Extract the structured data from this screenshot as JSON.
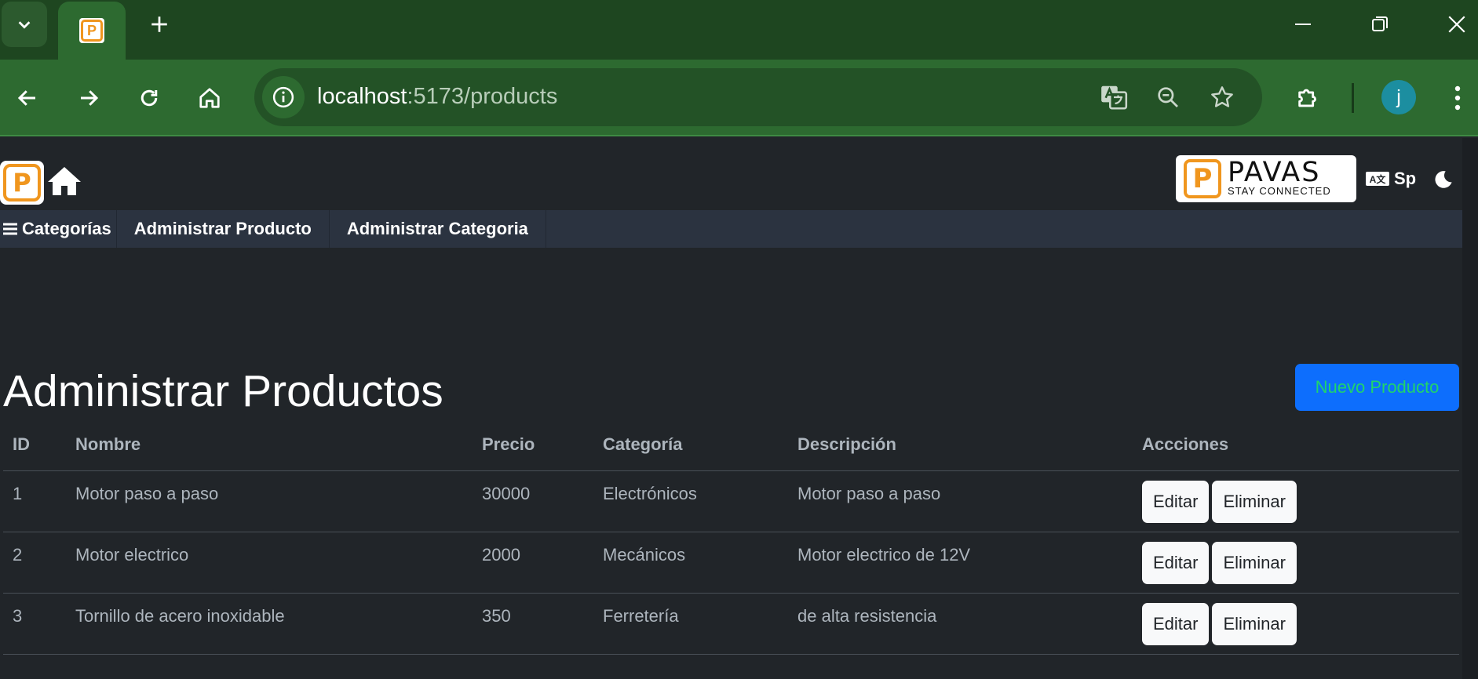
{
  "browser": {
    "tab_icon_letter": "P",
    "address": {
      "host": "localhost",
      "path": ":5173/products"
    },
    "profile_initial": "j",
    "colors": {
      "frame": "#1e4620",
      "toolbar": "#2d6a30",
      "omnibox": "#235226",
      "avatar": "#1c8ea0"
    }
  },
  "header": {
    "brand_letter": "P",
    "pavas_logo": {
      "name": "PAVAS",
      "tagline": "STAY CONNECTED"
    },
    "language": {
      "icon_text": "A文",
      "label": "Sp"
    }
  },
  "menu": {
    "items": [
      {
        "label": "Categorías"
      },
      {
        "label": "Administrar Producto"
      },
      {
        "label": "Administrar Categoria"
      }
    ]
  },
  "main": {
    "title": "Administrar Productos",
    "new_button": "Nuevo Producto",
    "table": {
      "headers": [
        "ID",
        "Nombre",
        "Precio",
        "Categoría",
        "Descripción",
        "Accciones"
      ],
      "rows": [
        {
          "id": "1",
          "name": "Motor paso a paso",
          "price": "30000",
          "category": "Electrónicos",
          "description": "Motor paso a paso",
          "edit": "Editar",
          "delete": "Eliminar"
        },
        {
          "id": "2",
          "name": "Motor electrico",
          "price": "2000",
          "category": "Mecánicos",
          "description": "Motor electrico de 12V",
          "edit": "Editar",
          "delete": "Eliminar"
        },
        {
          "id": "3",
          "name": "Tornillo de acero inoxidable",
          "price": "350",
          "category": "Ferretería",
          "description": "de alta resistencia",
          "edit": "Editar",
          "delete": "Eliminar"
        }
      ]
    }
  },
  "colors": {
    "background": "#212529",
    "menubar": "#2b3340",
    "primary": "#0d6efd",
    "brand_orange": "#f0961e"
  }
}
